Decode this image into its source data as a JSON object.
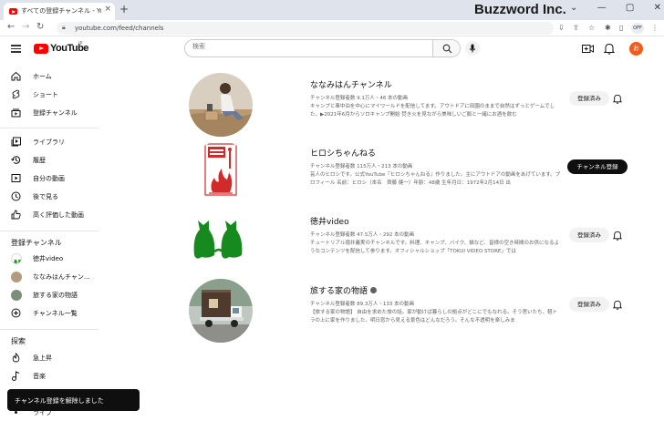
{
  "browser": {
    "tab_title": "すべての登録チャンネル - YouTube",
    "url": "youtube.com/feed/channels",
    "profile": "OFF"
  },
  "watermark": "Buzzword Inc.",
  "header": {
    "logo_text": "YouTube",
    "country": "JP",
    "search_placeholder": "検索",
    "avatar_letter": "お"
  },
  "sidebar": {
    "main": [
      {
        "label": "ホーム",
        "icon": "home-icon"
      },
      {
        "label": "ショート",
        "icon": "shorts-icon"
      },
      {
        "label": "登録チャンネル",
        "icon": "subscriptions-icon"
      }
    ],
    "library": [
      {
        "label": "ライブラリ",
        "icon": "library-icon"
      },
      {
        "label": "履歴",
        "icon": "history-icon"
      },
      {
        "label": "自分の動画",
        "icon": "my-videos-icon"
      },
      {
        "label": "後で見る",
        "icon": "watch-later-icon"
      },
      {
        "label": "高く評価した動画",
        "icon": "liked-icon"
      }
    ],
    "subs_heading": "登録チャンネル",
    "subs": [
      {
        "label": "徳井video"
      },
      {
        "label": "ななみはんチャン..."
      },
      {
        "label": "旅する家の物語"
      },
      {
        "label": "チャンネル一覧"
      }
    ],
    "explore_heading": "探索",
    "explore": [
      {
        "label": "急上昇",
        "icon": "trending-icon"
      },
      {
        "label": "音楽",
        "icon": "music-icon"
      },
      {
        "label": "ライブ",
        "icon": "live-icon"
      }
    ]
  },
  "channels": [
    {
      "name": "ななみはんチャンネル",
      "meta": "チャンネル登録者数 9.1万人・46 本の動画",
      "desc": "キャンプと車中泊を中心にマイワールドを配信してます。アウトドアに田園のままで自然はずっとゲームでした。▶2021年6月からソロキャンプ開始 焚き火を見ながら美味しいご飯と一緒にお酒を飲む",
      "button": "登録済み",
      "subscribed": true
    },
    {
      "name": "ヒロシちゃんねる",
      "meta": "チャンネル登録者数 115万人・213 本の動画",
      "desc": "芸人のヒロシです。公式YouTube『ヒロシちゃんねる』作りました。主にアウトドアの動画をあげています。プロフィール 名前：ヒロシ（本名　齊藤 健一）年齢：48歳 生年月日：1972年2月14日 出",
      "button": "チャンネル登録",
      "subscribed": false
    },
    {
      "name": "徳井video",
      "meta": "チャンネル登録者数 47.5万人・292 本の動画",
      "desc": "チュートリアル徳井義実のチャンネルです。料理、キャンプ、バイク、猫など、皆様の空き時間のお供になるようなコンテンツを配信して参ります。オフィシャルショップ「TOKUI VIDEO STORE」では",
      "button": "登録済み",
      "subscribed": true
    },
    {
      "name": "旅する家の物語",
      "meta": "チャンネル登録者数 89.3万人・133 本の動画",
      "desc": "【旅する家の物語】 自由を求めた旅の話。家が動けば暮らしの拠点がどこにでもなれる。そう思いたち、軽トラの上に家を作りました。明日窓から見える景色はどんなだろう。そんな不透明を楽しみま",
      "button": "登録済み",
      "subscribed": true
    }
  ],
  "snackbar": "チャンネル登録を解除しました",
  "colors": {
    "brand": "#ff0000",
    "avatar": "#ef5c1c",
    "cat_green": "#178a1f"
  }
}
